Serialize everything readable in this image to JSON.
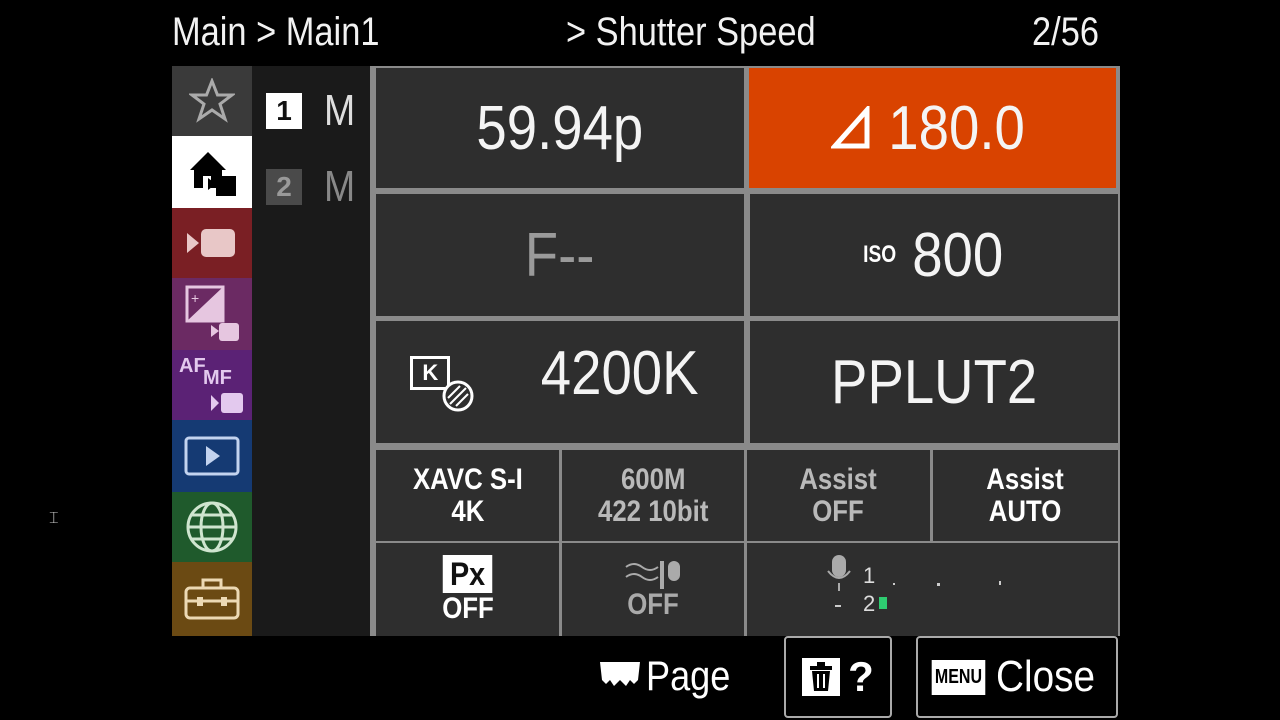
{
  "header": {
    "breadcrumb": "Main > Main1",
    "current_setting": "> Shutter Speed",
    "page_counter": "2/56"
  },
  "sidebar": {
    "items": [
      {
        "icon": "star-icon",
        "color": "#3a3a3a"
      },
      {
        "icon": "home-camera-icon",
        "color": "#ffffff",
        "selected": true
      },
      {
        "icon": "video-camera-icon",
        "color": "#7a1f24"
      },
      {
        "icon": "exposure-icon",
        "color": "#6b2a63"
      },
      {
        "icon": "af-mf-icon",
        "color": "#5b2275",
        "label_af": "AF",
        "label_mf": "MF"
      },
      {
        "icon": "playback-icon",
        "color": "#153a73"
      },
      {
        "icon": "globe-icon",
        "color": "#1f5a2c"
      },
      {
        "icon": "toolbox-icon",
        "color": "#6b4a13"
      }
    ]
  },
  "pages": [
    {
      "number": "1",
      "label": "M",
      "selected": true
    },
    {
      "number": "2",
      "label": "M",
      "selected": false
    }
  ],
  "tiles": {
    "frame_rate": "59.94p",
    "shutter_angle": "180.0",
    "aperture": "F--",
    "iso_label": "ISO",
    "iso_value": "800",
    "white_balance": "4200K",
    "wb_badge": "K",
    "look": "PPLUT2",
    "codec_line1": "XAVC S-I",
    "codec_line2": "4K",
    "bitrate_line1": "600M",
    "bitrate_line2": "422 10bit",
    "assist1_line1": "Assist",
    "assist1_line2": "OFF",
    "assist2_line1": "Assist",
    "assist2_line2": "AUTO",
    "proxy_badge": "Px",
    "proxy_value": "OFF",
    "wind_value": "OFF",
    "audio_ch1": "1",
    "audio_ch2": "2"
  },
  "colors": {
    "accent": "#d94300",
    "tile_bg": "#2e2e2e",
    "divider": "#8a8a8a"
  },
  "footer": {
    "page_label": "Page",
    "help_label": "?",
    "menu_badge": "MENU",
    "close_label": "Close"
  }
}
